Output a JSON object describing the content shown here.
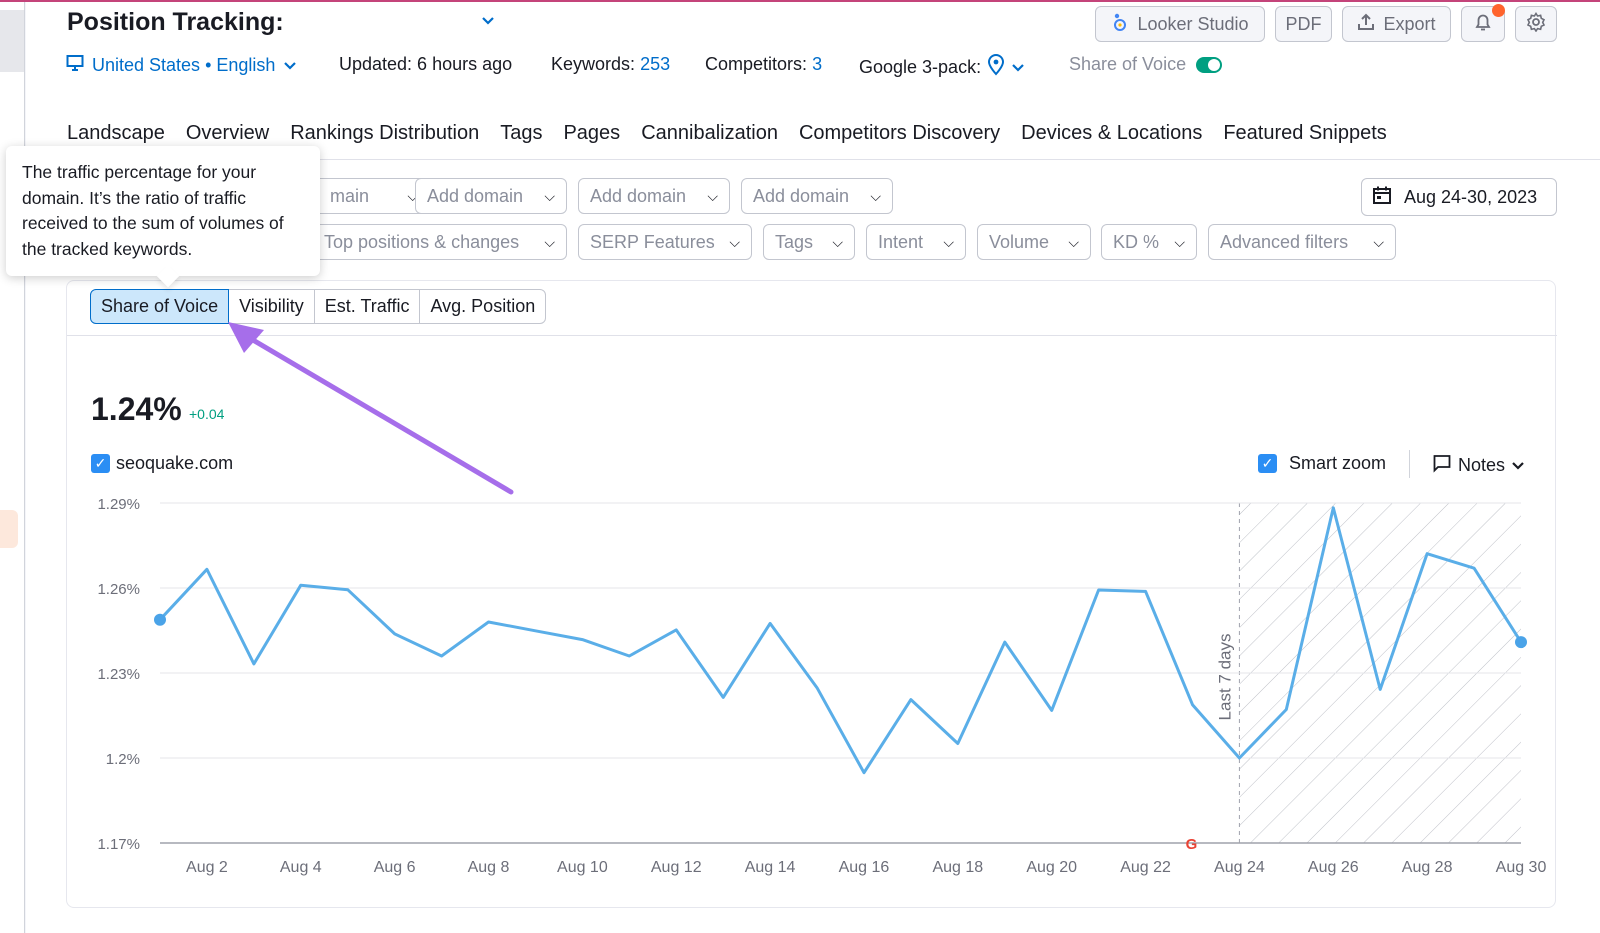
{
  "header": {
    "title": "Position Tracking:",
    "location": "United States • English",
    "updated": "Updated: 6 hours ago",
    "keywords_label": "Keywords:",
    "keywords_value": "253",
    "competitors_label": "Competitors:",
    "competitors_value": "3",
    "google_pack_label": "Google 3-pack:",
    "share_of_voice_label": "Share of Voice",
    "share_of_voice_toggle": "on",
    "buttons": {
      "looker": "Looker Studio",
      "pdf": "PDF",
      "export": "Export"
    }
  },
  "tabs": [
    "Landscape",
    "Overview",
    "Rankings Distribution",
    "Tags",
    "Pages",
    "Cannibalization",
    "Competitors Discovery",
    "Devices & Locations",
    "Featured Snippets"
  ],
  "filters": {
    "domain_partial": "main",
    "add_domain": [
      "Add domain",
      "Add domain",
      "Add domain"
    ],
    "date_range": "Aug 24-30, 2023",
    "row2": [
      "Top positions & changes",
      "SERP Features",
      "Tags",
      "Intent",
      "Volume",
      "KD %",
      "Advanced filters"
    ]
  },
  "tooltip": {
    "text": "The traffic percentage for your domain. It’s the ratio of traffic received to the sum of volumes of the tracked keywords."
  },
  "metric_tabs": [
    "Share of Voice",
    "Visibility",
    "Est. Traffic",
    "Avg. Position"
  ],
  "summary": {
    "value": "1.24%",
    "delta": "+0.04",
    "domain": "seoquake.com",
    "smart_zoom": "Smart zoom",
    "notes": "Notes"
  },
  "colors": {
    "accent": "#006dca",
    "line": "#5aaee8",
    "arrow": "#a66eea",
    "positive": "#009f81",
    "notification": "#ff642d"
  },
  "chart_data": {
    "type": "line",
    "series": [
      {
        "name": "seoquake.com",
        "values": [
          1.2488,
          1.2666,
          1.2332,
          1.261,
          1.2594,
          1.2438,
          1.236,
          1.248,
          1.2449,
          1.2418,
          1.236,
          1.2452,
          1.2214,
          1.2475,
          1.2248,
          1.1948,
          1.2206,
          1.2051,
          1.2409,
          1.2168,
          1.2593,
          1.2588,
          1.2188,
          1.2,
          1.2171,
          1.2883,
          1.2242,
          1.2721,
          1.267,
          1.2409
        ]
      }
    ],
    "x": [
      "Aug 1",
      "Aug 2",
      "Aug 3",
      "Aug 4",
      "Aug 5",
      "Aug 6",
      "Aug 7",
      "Aug 8",
      "Aug 9",
      "Aug 10",
      "Aug 11",
      "Aug 12",
      "Aug 13",
      "Aug 14",
      "Aug 15",
      "Aug 16",
      "Aug 17",
      "Aug 18",
      "Aug 19",
      "Aug 20",
      "Aug 21",
      "Aug 22",
      "Aug 23",
      "Aug 24",
      "Aug 25",
      "Aug 26",
      "Aug 27",
      "Aug 28",
      "Aug 29",
      "Aug 30"
    ],
    "x_tick_labels": [
      "Aug 2",
      "Aug 4",
      "Aug 6",
      "Aug 8",
      "Aug 10",
      "Aug 12",
      "Aug 14",
      "Aug 16",
      "Aug 18",
      "Aug 20",
      "Aug 22",
      "Aug 24",
      "Aug 26",
      "Aug 28",
      "Aug 30"
    ],
    "y_tick_labels": [
      "1.29%",
      "1.26%",
      "1.23%",
      "1.2%",
      "1.17%"
    ],
    "y_ticks": [
      1.29,
      1.26,
      1.23,
      1.2,
      1.17
    ],
    "ylim": [
      1.17,
      1.29
    ],
    "highlight_range": [
      "Aug 24",
      "Aug 30"
    ],
    "highlight_label": "Last 7 days",
    "grid": true
  }
}
